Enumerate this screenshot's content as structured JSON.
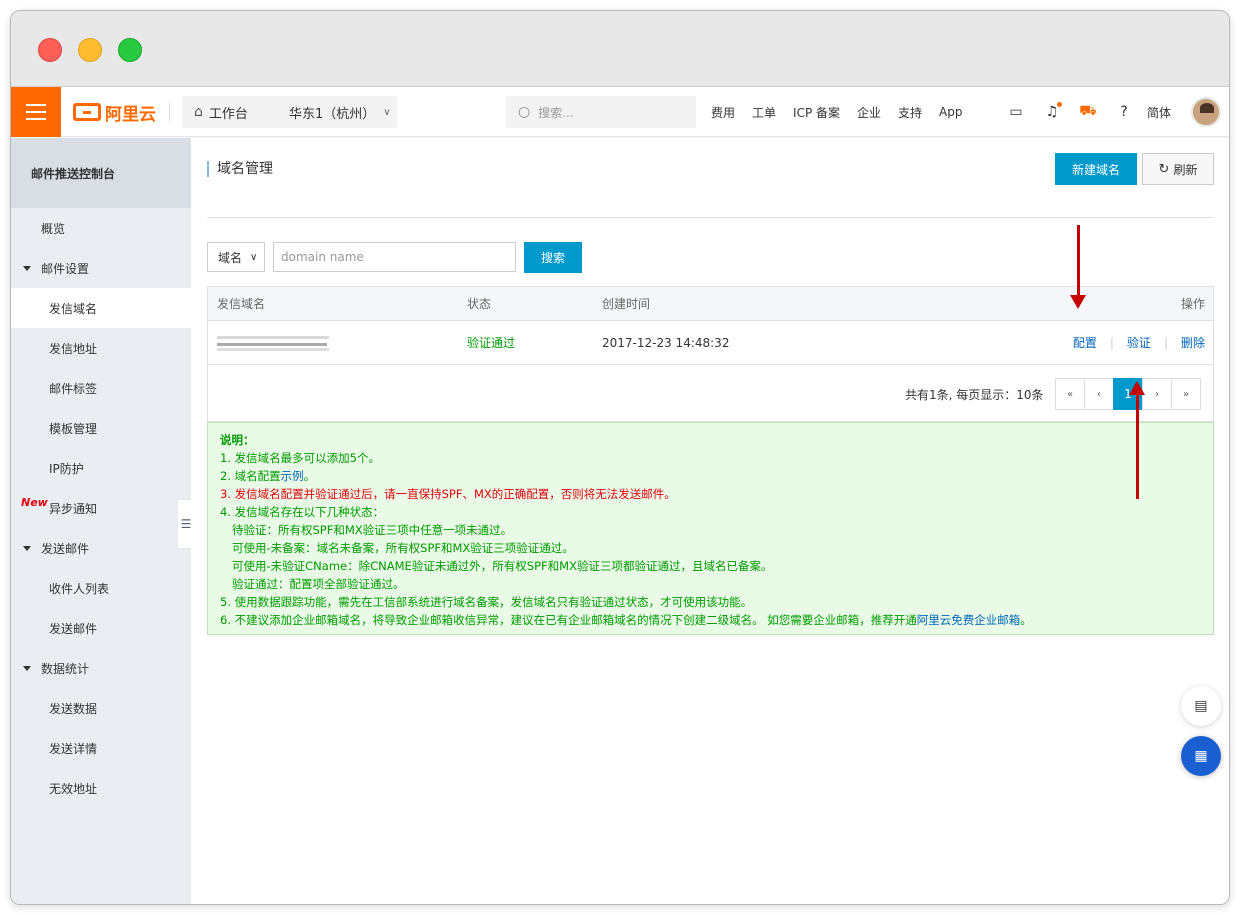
{
  "topbar": {
    "logo_text": "阿里云",
    "workbench": "工作台",
    "region": "华东1（杭州）",
    "search_placeholder": "搜索...",
    "links": [
      "费用",
      "工单",
      "ICP 备案",
      "企业",
      "支持",
      "App"
    ],
    "language": "简体",
    "accent_color": "#ff6a00"
  },
  "sidebar": {
    "title": "邮件推送控制台",
    "items": [
      {
        "label": "概览"
      },
      {
        "label": "邮件设置"
      },
      {
        "label": "发信域名"
      },
      {
        "label": "发信地址"
      },
      {
        "label": "邮件标签"
      },
      {
        "label": "模板管理"
      },
      {
        "label": "IP防护"
      },
      {
        "label": "异步通知",
        "badge": "New"
      },
      {
        "label": "发送邮件"
      },
      {
        "label": "收件人列表"
      },
      {
        "label": "发送邮件"
      },
      {
        "label": "数据统计"
      },
      {
        "label": "发送数据"
      },
      {
        "label": "发送详情"
      },
      {
        "label": "无效地址"
      }
    ]
  },
  "main": {
    "title": "域名管理",
    "new_button": "新建域名",
    "refresh_button": "刷新",
    "filter": {
      "select_value": "域名",
      "input_placeholder": "domain name",
      "search_button": "搜索"
    },
    "table": {
      "headers": [
        "发信域名",
        "状态",
        "创建时间",
        "操作"
      ],
      "rows": [
        {
          "status": "验证通过",
          "created": "2017-12-23 14:48:32",
          "actions": [
            "配置",
            "验证",
            "删除"
          ]
        }
      ]
    },
    "pagination": {
      "info": "共有1条, 每页显示：10条",
      "first": "«",
      "prev": "‹",
      "current": "1",
      "next": "›",
      "last": "»"
    },
    "notes": {
      "heading": "说明：",
      "line1": "1. 发信域名最多可以添加5个。",
      "line2_prefix": "2. 域名配置",
      "line2_link": "示例",
      "line2_suffix": "。",
      "line3": "3. 发信域名配置并验证通过后，请一直保持SPF、MX的正确配置，否则将无法发送邮件。",
      "line4": "4. 发信域名存在以下几种状态：",
      "line4a": "待验证：所有权SPF和MX验证三项中任意一项未通过。",
      "line4b": "可使用-未备案：域名未备案，所有权SPF和MX验证三项验证通过。",
      "line4c": "可使用-未验证CName：除CNAME验证未通过外，所有权SPF和MX验证三项都验证通过，且域名已备案。",
      "line4d": "验证通过：配置项全部验证通过。",
      "line5": "5. 使用数据跟踪功能，需先在工信部系统进行域名备案，发信域名只有验证通过状态，才可使用该功能。",
      "line6_prefix": "6. 不建议添加企业邮箱域名，将导致企业邮箱收信异常，建议在已有企业邮箱域名的情况下创建二级域名。 如您需要企业邮箱，推荐开通",
      "line6_link": "阿里云免费企业邮箱",
      "line6_suffix": "。"
    }
  }
}
